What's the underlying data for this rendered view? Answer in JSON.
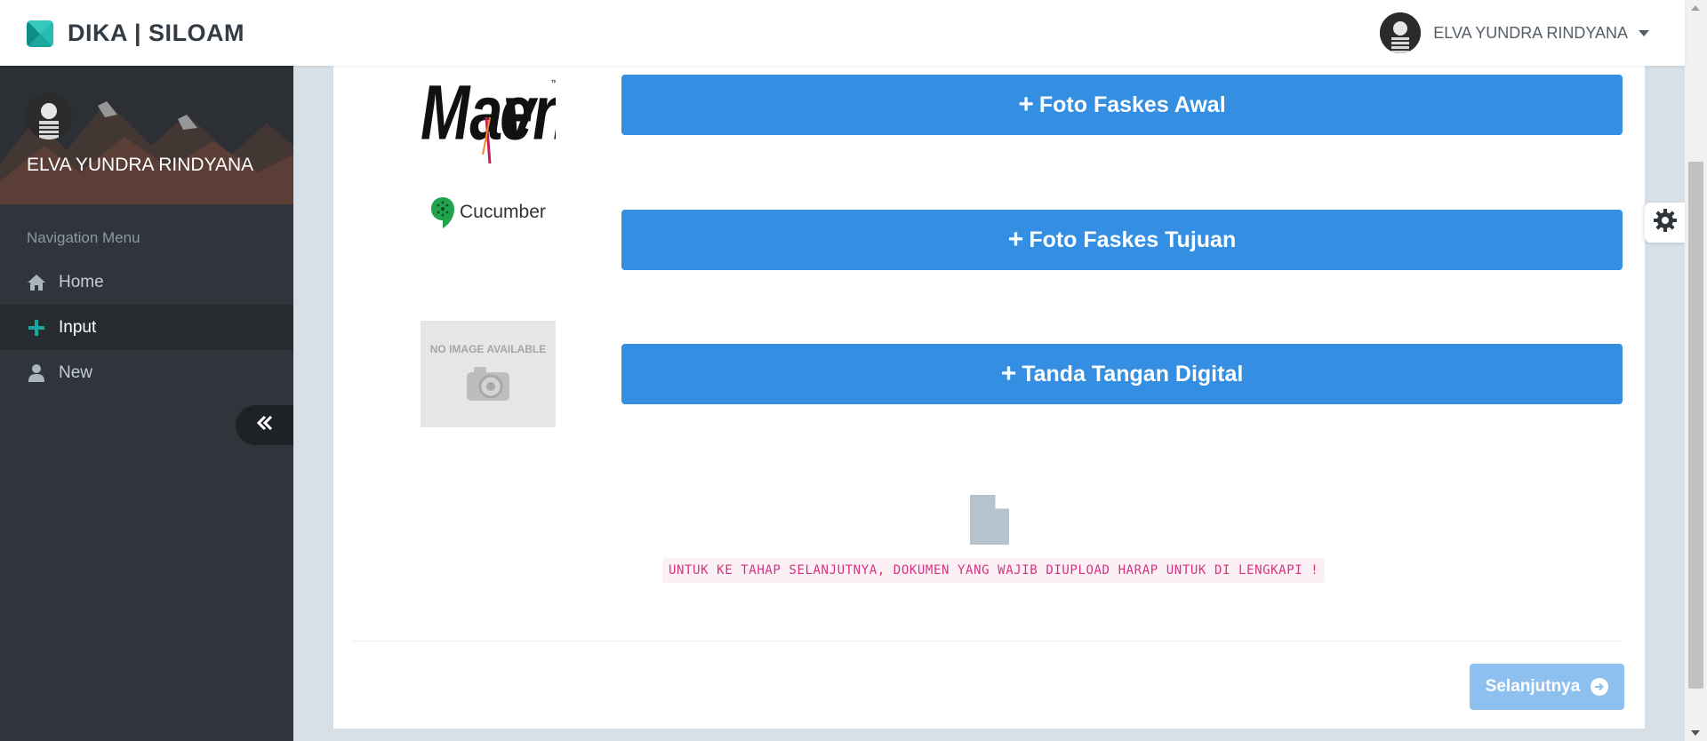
{
  "app": {
    "brand": "DIKA | SILOAM"
  },
  "user": {
    "name": "ELVA YUNDRA RINDYANA"
  },
  "sidebar": {
    "profile_name": "ELVA YUNDRA RINDYANA",
    "nav_header": "Navigation Menu",
    "items": [
      {
        "label": "Home",
        "icon": "home-icon"
      },
      {
        "label": "Input",
        "icon": "plus-icon",
        "active": true
      },
      {
        "label": "New",
        "icon": "user-icon"
      }
    ]
  },
  "main": {
    "rows": [
      {
        "image_label": "Maven",
        "button_label": "Foto Faskes Awal"
      },
      {
        "image_label": "Cucumber",
        "button_label": "Foto Faskes Tujuan"
      },
      {
        "image_label": "NO IMAGE AVAILABLE",
        "button_label": "Tanda Tangan Digital"
      }
    ],
    "warning": "UNTUK KE TAHAP SELANJUTNYA, DOKUMEN YANG WAJIB DIUPLOAD HARAP UNTUK DI LENGKAPI !",
    "next_label": "Selanjutnya"
  },
  "colors": {
    "primary_button": "#348fe2",
    "disabled_button": "#8dc0ee",
    "brand": "#1aa7a0",
    "sidebar": "#2f353b",
    "warning_text": "#d63384"
  }
}
